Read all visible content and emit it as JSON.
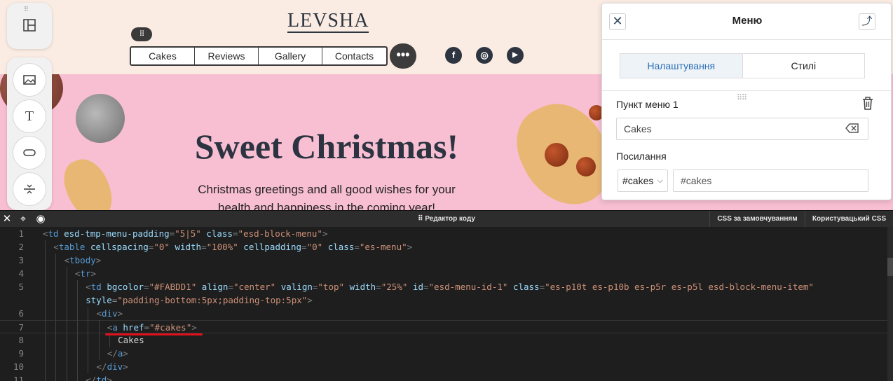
{
  "canvas": {
    "logo": "LEVSHA",
    "menu_handle": "⠿",
    "menu": [
      {
        "label": "Cakes",
        "active": true
      },
      {
        "label": "Reviews",
        "active": false
      },
      {
        "label": "Gallery",
        "active": false
      },
      {
        "label": "Contacts",
        "active": false
      }
    ],
    "more_label": "•••",
    "social": [
      {
        "icon": "facebook-icon",
        "glyph": "f"
      },
      {
        "icon": "instagram-icon",
        "glyph": "◎"
      },
      {
        "icon": "youtube-icon",
        "glyph": "▶"
      }
    ],
    "hero_title": "Sweet Christmas!",
    "hero_sub_1": "Christmas greetings and all good wishes for your",
    "hero_sub_2": "health and happiness in the coming year!",
    "colors": {
      "header_bg": "#faece2",
      "banner_bg": "#f8bed2",
      "active_menu": "#f6b8d0",
      "text_dark": "#2b3440"
    }
  },
  "toolbar": {
    "top_icon": "layout-icon",
    "tools": [
      "image-icon",
      "text-icon",
      "button-icon",
      "spacer-icon"
    ]
  },
  "panel": {
    "title": "Меню",
    "tabs": [
      "Налаштування",
      "Стилі"
    ],
    "item_label": "Пункт меню 1",
    "item_value": "Cakes",
    "link_label": "Посилання",
    "link_type": "#cakes",
    "link_value": "#cakes"
  },
  "editor": {
    "title": "Редактор коду",
    "btn_default_css": "CSS за замовчуванням",
    "btn_custom_css": "Користувацький CSS",
    "current_line": 7,
    "lines": [
      {
        "n": "1",
        "indent": 0,
        "tokens": [
          [
            "p",
            "<"
          ],
          [
            "t",
            "td"
          ],
          [
            "s",
            " "
          ],
          [
            "a",
            "esd-tmp-menu-padding"
          ],
          [
            "p",
            "="
          ],
          [
            "v",
            "\"5|5\""
          ],
          [
            "s",
            " "
          ],
          [
            "a",
            "class"
          ],
          [
            "p",
            "="
          ],
          [
            "v",
            "\"esd-block-menu\""
          ],
          [
            "p",
            ">"
          ]
        ]
      },
      {
        "n": "2",
        "indent": 1,
        "tokens": [
          [
            "p",
            "<"
          ],
          [
            "t",
            "table"
          ],
          [
            "s",
            " "
          ],
          [
            "a",
            "cellspacing"
          ],
          [
            "p",
            "="
          ],
          [
            "v",
            "\"0\""
          ],
          [
            "s",
            " "
          ],
          [
            "a",
            "width"
          ],
          [
            "p",
            "="
          ],
          [
            "v",
            "\"100%\""
          ],
          [
            "s",
            " "
          ],
          [
            "a",
            "cellpadding"
          ],
          [
            "p",
            "="
          ],
          [
            "v",
            "\"0\""
          ],
          [
            "s",
            " "
          ],
          [
            "a",
            "class"
          ],
          [
            "p",
            "="
          ],
          [
            "v",
            "\"es-menu\""
          ],
          [
            "p",
            ">"
          ]
        ]
      },
      {
        "n": "3",
        "indent": 2,
        "tokens": [
          [
            "p",
            "<"
          ],
          [
            "t",
            "tbody"
          ],
          [
            "p",
            ">"
          ]
        ]
      },
      {
        "n": "4",
        "indent": 3,
        "tokens": [
          [
            "p",
            "<"
          ],
          [
            "t",
            "tr"
          ],
          [
            "p",
            ">"
          ]
        ]
      },
      {
        "n": "5",
        "indent": 4,
        "tokens": [
          [
            "p",
            "<"
          ],
          [
            "t",
            "td"
          ],
          [
            "s",
            " "
          ],
          [
            "a",
            "bgcolor"
          ],
          [
            "p",
            "="
          ],
          [
            "v",
            "\"#FABDD1\""
          ],
          [
            "s",
            " "
          ],
          [
            "a",
            "align"
          ],
          [
            "p",
            "="
          ],
          [
            "v",
            "\"center\""
          ],
          [
            "s",
            " "
          ],
          [
            "a",
            "valign"
          ],
          [
            "p",
            "="
          ],
          [
            "v",
            "\"top\""
          ],
          [
            "s",
            " "
          ],
          [
            "a",
            "width"
          ],
          [
            "p",
            "="
          ],
          [
            "v",
            "\"25%\""
          ],
          [
            "s",
            " "
          ],
          [
            "a",
            "id"
          ],
          [
            "p",
            "="
          ],
          [
            "v",
            "\"esd-menu-id-1\""
          ],
          [
            "s",
            " "
          ],
          [
            "a",
            "class"
          ],
          [
            "p",
            "="
          ],
          [
            "v",
            "\"es-p10t es-p10b es-p5r es-p5l esd-block-menu-item\""
          ]
        ]
      },
      {
        "n": "",
        "indent": 4,
        "tokens": [
          [
            "a",
            "style"
          ],
          [
            "p",
            "="
          ],
          [
            "v",
            "\"padding-bottom:5px;padding-top:5px\""
          ],
          [
            "p",
            ">"
          ]
        ]
      },
      {
        "n": "6",
        "indent": 5,
        "tokens": [
          [
            "p",
            "<"
          ],
          [
            "t",
            "div"
          ],
          [
            "p",
            ">"
          ]
        ]
      },
      {
        "n": "7",
        "indent": 6,
        "tokens": [
          [
            "p",
            "<"
          ],
          [
            "t",
            "a"
          ],
          [
            "s",
            " "
          ],
          [
            "a",
            "href"
          ],
          [
            "p",
            "="
          ],
          [
            "v",
            "\"#cakes\""
          ],
          [
            "p",
            ">"
          ]
        ]
      },
      {
        "n": "8",
        "indent": 7,
        "tokens": [
          [
            "x",
            "Cakes"
          ]
        ]
      },
      {
        "n": "9",
        "indent": 6,
        "tokens": [
          [
            "p",
            "</"
          ],
          [
            "t",
            "a"
          ],
          [
            "p",
            ">"
          ]
        ]
      },
      {
        "n": "10",
        "indent": 5,
        "tokens": [
          [
            "p",
            "</"
          ],
          [
            "t",
            "div"
          ],
          [
            "p",
            ">"
          ]
        ]
      },
      {
        "n": "11",
        "indent": 4,
        "tokens": [
          [
            "p",
            "</"
          ],
          [
            "t",
            "td"
          ],
          [
            "p",
            ">"
          ]
        ]
      }
    ]
  }
}
